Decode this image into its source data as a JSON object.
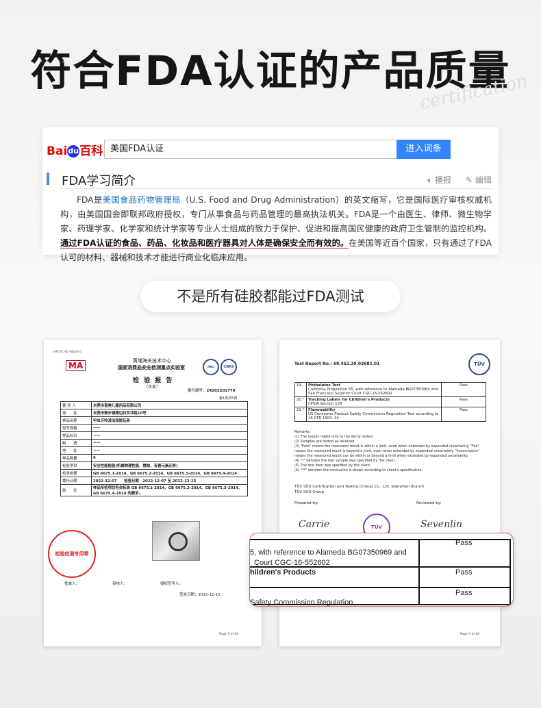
{
  "header": {
    "title": "符合FDA认证的产品质量",
    "watermark": "certification"
  },
  "baike": {
    "logo_red": "Bai",
    "logo_paw": "du",
    "logo_baike": "百科",
    "search_value": "美国FDA认证",
    "search_button": "进入词条",
    "section_title": "FDA学习简介",
    "listen": "播报",
    "edit": "编辑",
    "p1": "FDA是",
    "p_link": "美国食品药物管理局",
    "p2": "（U.S. Food and Drug Administration）的英文缩写，它是国际医疗审核权威机构，由美国国会即联邦政府授权，专门从事食品与药品管理的最高执法机关。FDA是一个由医生、律师、微生物学家、药理学家、化学家和统计学家等专业人士组成的致力于保护、促进和提高国民健康的政府卫生管制的监控机构。",
    "p_highlight": "通过FDA认证的食品、药品、化妆品和医疗器具对人体是确保安全而有效的。",
    "p3": "在美国等近百个国家，只有通过了FDA认可的材料、器械和技术才能进行商业化临床应用。"
  },
  "subtitle": "不是所有硅胶都能过FDA测试",
  "doc_left": {
    "code": "HPCTC-R1-A026-G",
    "cma": "MA",
    "org_line1": "黄埔海关技术中心",
    "org_line2": "国家消费品安全检测重点实验室",
    "report_title": "检 验 报 告",
    "report_sub": "（正本）",
    "report_no_label": "委托编号：",
    "report_no": "24202201779",
    "page": "第1页共5页",
    "rows": [
      {
        "label": "委 托 人",
        "value": "东莞市富美儿童用品有限公司"
      },
      {
        "label": "地　　址",
        "value": "东莞市寮步镇樟边村凤冲路10号"
      },
      {
        "label": "样品名称",
        "value": "甲虫牙咬清洁软胶玩具"
      },
      {
        "label": "型号规格",
        "value": "——"
      },
      {
        "label": "样品标识",
        "value": "——"
      },
      {
        "label": "制　　造",
        "value": "——"
      },
      {
        "label": "地　　址",
        "value": "——"
      },
      {
        "label": "样品数量",
        "value": "6"
      },
      {
        "label": "检验项目",
        "value": "安全性能检验(机械物理性能、燃烧、有害元素迁移)"
      },
      {
        "label": "检验依据",
        "value": "GB 6675.1-2014、GB 6675.2-2014、GB 6675.3-2014、GB 6675.4-2014"
      },
      {
        "label": "委托日期",
        "value": "2022-12-07　　检验日期　2022-12-07 至 2022-12-15"
      },
      {
        "label": "结　　论",
        "value": "样品所检项目符合标准 GB 6675.1-2014、GB 6675.2-2014、GB 6675.3-2014、GB 6675.4-2014 的要求。"
      }
    ],
    "stamp": "检验检测专用章",
    "sign_approve": "批准人：",
    "sign_review": "审核人：",
    "sign_authorized": "授权签字人：",
    "issue_date": "签发日期：2022-12-15",
    "footer_page": "Page 5 of 20"
  },
  "doc_right": {
    "report_no": "Test Report No.: 68.452.20.02681.01",
    "tuv": "TÜV",
    "rows": [
      {
        "no": "19.",
        "item": "Phthalates Test",
        "desc": "California Proposition 65, with reference to Alameda BG07350969 and San Francisco Superior Court CGC-16-552602",
        "result": "Pass"
      },
      {
        "no": "20.*",
        "item": "Tracking Labels for Children's Products",
        "desc": "CPSIA Section 103",
        "result": "Pass"
      },
      {
        "no": "21.*",
        "item": "Flammability",
        "desc": "US Consumer Product Safety Commission Regulation Test according to 16 CFR 1500. 44",
        "result": "Pass"
      }
    ],
    "remarks_title": "Remarks:",
    "remarks": [
      "(1) The results relate only to the items tested.",
      "(2) Samples are tested as received.",
      "(3) \"Pass\" means the measured result is within a limit, even when extended by expanded uncertainty. \"Fail\" means the measured result is beyond a limit, even when extended by expanded uncertainty. \"Inconclusive\" means the measured result can be within or beyond a limit when extended by expanded uncertainty.",
      "(4) \"*\" denotes the test sample was specified by the client.",
      "(5) The test item was specified by the client.",
      "(6) \"**\" denotes the conclusion is drawn according to client's specification."
    ],
    "company_line1": "TÜV SÜD Certification and Testing (China) Co., Ltd. Shenzhen Branch",
    "company_line2": "TÜV SÜD Group",
    "prepared_by": "Prepared by:",
    "reviewed_by": "Reviewed by:",
    "sig1": "Carrie",
    "sig2": "Sevenlin",
    "footer_page": "Page 3 of 20"
  },
  "zoom": {
    "row1_text1": "5, with reference to Alameda BG07350969 and",
    "row1_text2": "Court CGC-16-552602",
    "row2_text": "hildren's Products",
    "row3_text": "Safety Commission Regulation",
    "pass": "Pass"
  }
}
